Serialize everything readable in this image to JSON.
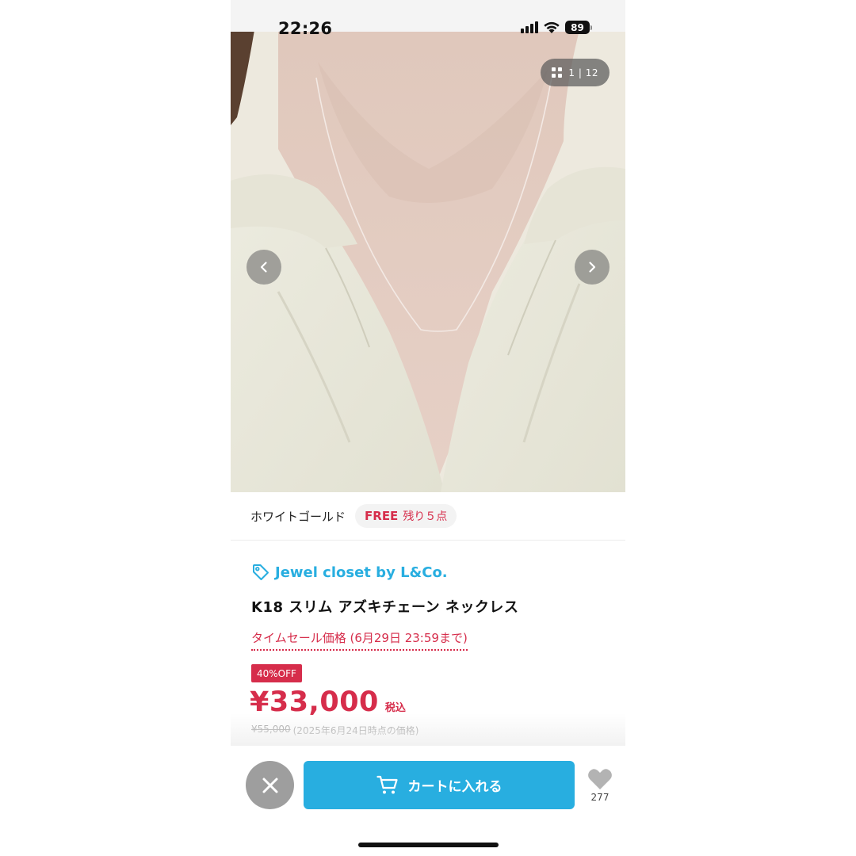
{
  "status_bar": {
    "time": "22:26",
    "battery": "89",
    "icons": [
      "signal-icon",
      "wifi-icon",
      "battery-icon"
    ]
  },
  "gallery": {
    "counter_current": "1",
    "counter_separator": "|",
    "counter_total": "12",
    "icons": [
      "grid-icon",
      "chevron-left-icon",
      "chevron-right-icon"
    ]
  },
  "variant": {
    "color": "ホワイトゴールド",
    "size": "FREE",
    "stock": "残り５点"
  },
  "product": {
    "brand": "Jewel closet by L&Co.",
    "title": "K18 スリム アズキチェーン ネックレス",
    "sale_label": "タイムセール価格 (6月29日 23:59まで)",
    "discount_badge": "40%OFF",
    "price": "¥33,000",
    "tax_label": "税込",
    "original_price": "¥55,000",
    "original_note": "(2025年6月24日時点の価格)"
  },
  "bottom_bar": {
    "cart_label": "カートに入れる",
    "favorite_count": "277",
    "icons": [
      "close-icon",
      "cart-icon",
      "heart-icon"
    ]
  },
  "colors": {
    "accent_blue": "#28aee0",
    "sale_red": "#d62d4b",
    "close_gray": "#9e9e9e"
  }
}
